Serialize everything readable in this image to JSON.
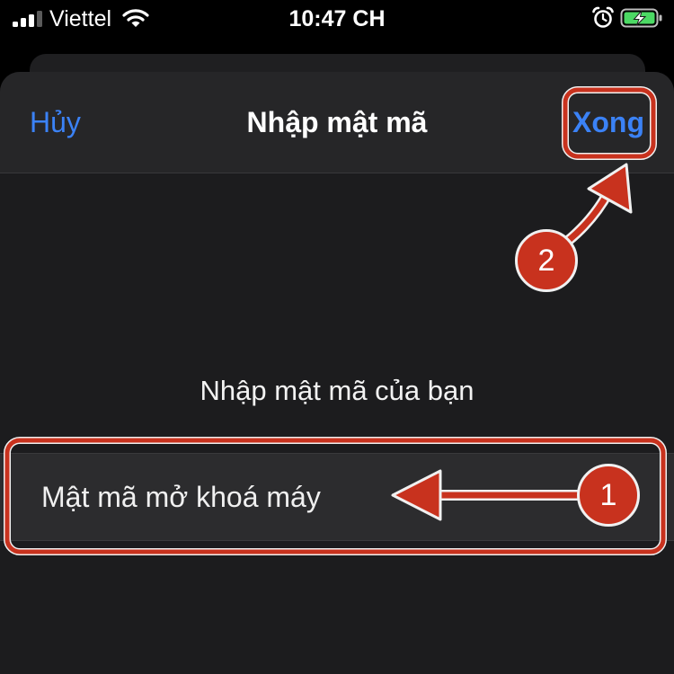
{
  "status_bar": {
    "carrier": "Viettel",
    "time": "10:47 CH",
    "signal_bars_active": 3,
    "battery_state": "charging",
    "icons": [
      "signal-icon",
      "wifi-icon",
      "alarm-icon",
      "battery-charging-icon"
    ]
  },
  "nav": {
    "cancel_label": "Hủy",
    "title": "Nhập mật mã",
    "done_label": "Xong"
  },
  "content": {
    "prompt": "Nhập mật mã của bạn",
    "passcode_placeholder": "Mật mã mở khoá máy",
    "passcode_value": ""
  },
  "annotations": {
    "step_1": "1",
    "step_2": "2"
  },
  "colors": {
    "accent": "#3b82f6",
    "annotation": "#c8321e",
    "battery_charge": "#4cd964",
    "background": "#000000",
    "sheet": "#1c1c1e"
  }
}
